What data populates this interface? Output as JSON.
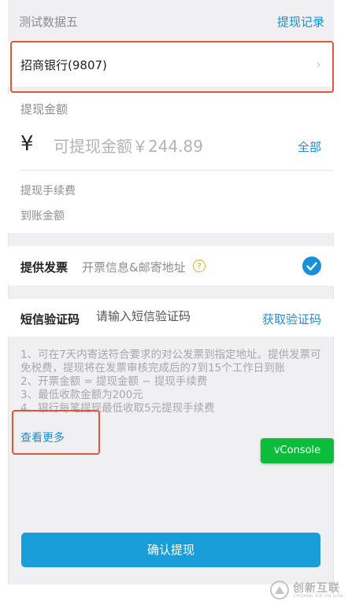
{
  "header": {
    "title": "测试数据五",
    "records": "提现记录"
  },
  "bank": {
    "name": "招商银行(9807)",
    "chevron": "›"
  },
  "amount": {
    "label": "提现金额",
    "currency": "¥",
    "available": "可提现金额￥244.89",
    "all": "全部",
    "fee_label": "提现手续费",
    "arrive_label": "到账金额"
  },
  "invoice": {
    "label": "提供发票",
    "hint": "开票信息&邮寄地址",
    "help": "?",
    "checked": true
  },
  "sms": {
    "label": "短信验证码",
    "placeholder": "请输入短信验证码",
    "get_code": "获取验证码"
  },
  "notes": [
    "1、可在7天内寄送符合要求的对公发票到指定地址。提供发票可免税费，提现将在发票审核完成后的7到15个工作日到账",
    "2、开票金额 = 提现金额 − 提现手续费",
    "3、最低收款金额为200元",
    "4、银行每笔提现最低收取5元提现手续费"
  ],
  "more": "查看更多",
  "vconsole": "vConsole",
  "confirm": "确认提现",
  "watermark": {
    "brand": "创新互联",
    "sub": "CHUANG XIN HU LIAN"
  },
  "colors": {
    "accent": "#1a8fd9",
    "button": "#1a9ed9",
    "highlight": "#e2553b",
    "vconsole": "#0bbd3a"
  }
}
